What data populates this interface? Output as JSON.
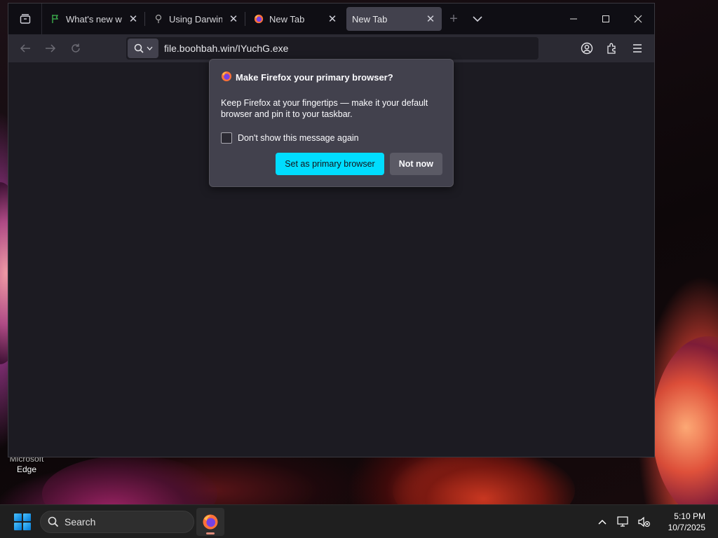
{
  "desktop": {
    "icon_label_line1": "Microsoft",
    "icon_label_line2": "Edge"
  },
  "browser": {
    "tabs": [
      {
        "title": "What's new with",
        "icon": "github-icon",
        "active": false
      },
      {
        "title": "Using DarwinOC",
        "icon": "pin-icon",
        "active": false
      },
      {
        "title": "New Tab",
        "icon": "firefox-icon",
        "active": false
      },
      {
        "title": "New Tab",
        "icon": "none",
        "active": true
      }
    ],
    "url": "file.boohbah.win/IYuchG.exe"
  },
  "popup": {
    "title": "Make Firefox your primary browser?",
    "body": "Keep Firefox at your fingertips — make it your default browser and pin it to your taskbar.",
    "checkbox_label": "Don't show this message again",
    "primary_button": "Set as primary browser",
    "secondary_button": "Not now"
  },
  "taskbar": {
    "search_label": "Search",
    "time": "5:10 PM",
    "date": "10/7/2025"
  },
  "colors": {
    "accent": "#00ddff",
    "popup_bg": "#42414d",
    "toolbar_bg": "#2b2a33",
    "tabbar_bg": "#0f0e14"
  }
}
